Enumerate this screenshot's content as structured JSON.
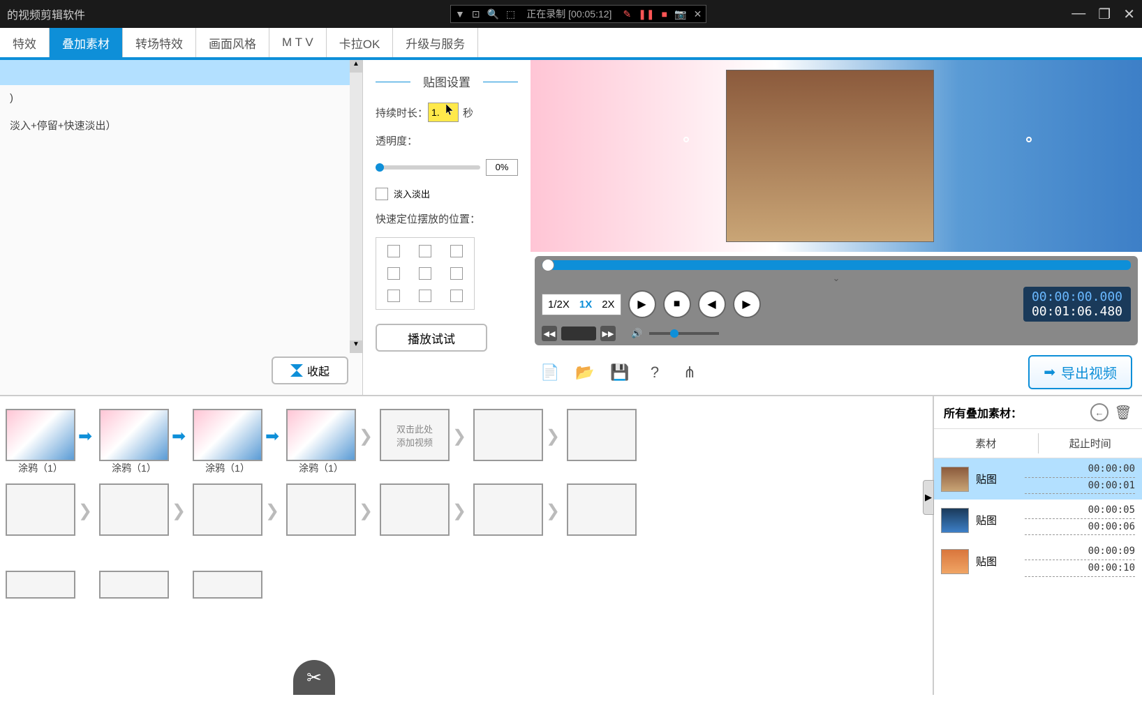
{
  "titlebar": {
    "app_title": "的视频剪辑软件",
    "rec_status": "正在录制 [00:05:12]"
  },
  "tabs": {
    "effects": "特效",
    "overlay": "叠加素材",
    "transition": "转场特效",
    "style": "画面风格",
    "mtv": "M T V",
    "karaoke": "卡拉OK",
    "upgrade": "升级与服务"
  },
  "list": {
    "item1": ")",
    "item2": "淡入+停留+快速淡出）",
    "collapse": "收起"
  },
  "settings": {
    "title": "贴图设置",
    "duration_label": "持续时长：",
    "duration_value": "1.",
    "duration_unit": "秒",
    "opacity_label": "透明度：",
    "opacity_value": "0%",
    "fade_label": "淡入淡出",
    "position_label": "快速定位摆放的位置：",
    "play_test": "播放试试"
  },
  "preview": {
    "speed_half": "1/2X",
    "speed_1x": "1X",
    "speed_2x": "2X",
    "time_current": "00:00:00.000",
    "time_total": "00:01:06.480",
    "export": "导出视频"
  },
  "timeline": {
    "clip_label": "涂鸦（1）",
    "placeholder": "双击此处\n添加视频"
  },
  "materials": {
    "title": "所有叠加素材：",
    "col_material": "素材",
    "col_time": "起止时间",
    "items": [
      {
        "name": "贴图",
        "start": "00:00:00",
        "end": "00:00:01"
      },
      {
        "name": "贴图",
        "start": "00:00:05",
        "end": "00:00:06"
      },
      {
        "name": "贴图",
        "start": "00:00:09",
        "end": "00:00:10"
      }
    ]
  }
}
